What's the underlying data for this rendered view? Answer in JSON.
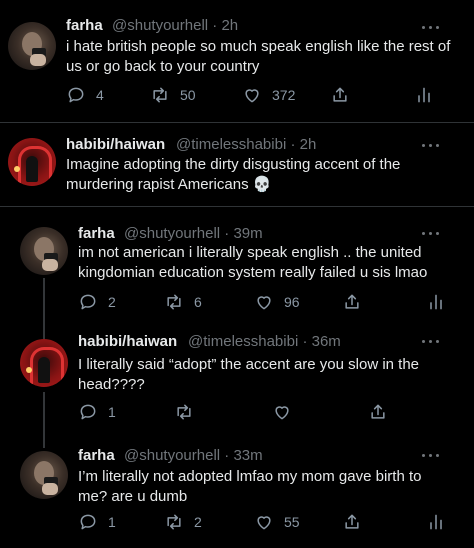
{
  "tweets": [
    {
      "name": "farha",
      "meta": "@shutyourhell · 2h",
      "text": "i hate british people so much speak english like the rest of us or go back to your country",
      "replies": "4",
      "retweets": "50",
      "likes": "372",
      "avatar": "farha"
    },
    {
      "name": "habibi/haiwan",
      "meta": "@timelesshabibi · 2h",
      "text": "Imagine adopting the dirty disgusting accent of the murdering rapist Americans 💀",
      "replies": "",
      "retweets": "",
      "likes": "",
      "avatar": "habibi"
    },
    {
      "name": "farha",
      "meta": "@shutyourhell · 39m",
      "text": "im not american i literally speak english .. the united kingdomian education system really failed u sis lmao",
      "replies": "2",
      "retweets": "6",
      "likes": "96",
      "avatar": "farha"
    },
    {
      "name": "habibi/haiwan",
      "meta": "@timelesshabibi · 36m",
      "text": "I literally said “adopt” the accent are you slow in the head????",
      "replies": "1",
      "retweets": "",
      "likes": "",
      "avatar": "habibi"
    },
    {
      "name": "farha",
      "meta": "@shutyourhell · 33m",
      "text": "I’m literally not adopted lmfao my mom gave birth to me? are u dumb",
      "replies": "1",
      "retweets": "2",
      "likes": "55",
      "avatar": "farha"
    }
  ],
  "icons": {
    "reply": "reply-icon",
    "retweet": "retweet-icon",
    "like": "like-icon",
    "share": "share-icon",
    "analytics": "analytics-icon",
    "more": "more-icon"
  },
  "colors": {
    "background": "#000000",
    "text": "#e7e9ea",
    "secondary": "#71767b",
    "divider": "#2f3336"
  }
}
